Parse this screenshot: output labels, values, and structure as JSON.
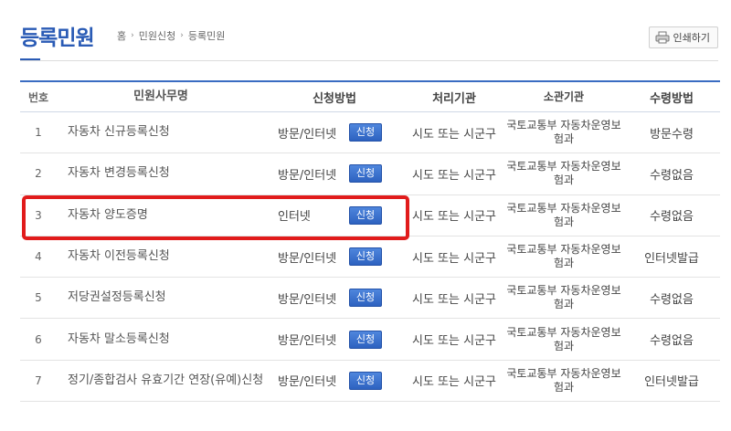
{
  "header": {
    "title": "등록민원",
    "breadcrumb": [
      "홈",
      "민원신청",
      "등록민원"
    ],
    "print_label": "인쇄하기"
  },
  "table": {
    "columns": [
      "번호",
      "민원사무명",
      "신청방법",
      "처리기관",
      "소관기관",
      "수령방법"
    ],
    "apply_label": "신청",
    "rows": [
      {
        "num": "1",
        "name": "자동차 신규등록신청",
        "method": "방문/인터넷",
        "agency": "시도 또는 시군구",
        "dept": "국토교통부 자동차운영보험과",
        "receive": "방문수령"
      },
      {
        "num": "2",
        "name": "자동차 변경등록신청",
        "method": "방문/인터넷",
        "agency": "시도 또는 시군구",
        "dept": "국토교통부 자동차운영보험과",
        "receive": "수령없음"
      },
      {
        "num": "3",
        "name": "자동차 양도증명",
        "method": "인터넷",
        "agency": "시도 또는 시군구",
        "dept": "국토교통부 자동차운영보험과",
        "receive": "수령없음"
      },
      {
        "num": "4",
        "name": "자동차 이전등록신청",
        "method": "방문/인터넷",
        "agency": "시도 또는 시군구",
        "dept": "국토교통부 자동차운영보험과",
        "receive": "인터넷발급"
      },
      {
        "num": "5",
        "name": "저당권설정등록신청",
        "method": "방문/인터넷",
        "agency": "시도 또는 시군구",
        "dept": "국토교통부 자동차운영보험과",
        "receive": "수령없음"
      },
      {
        "num": "6",
        "name": "자동차 말소등록신청",
        "method": "방문/인터넷",
        "agency": "시도 또는 시군구",
        "dept": "국토교통부 자동차운영보험과",
        "receive": "수령없음"
      },
      {
        "num": "7",
        "name": "정기/종합검사 유효기간 연장(유예)신청",
        "method": "방문/인터넷",
        "agency": "시도 또는 시군구",
        "dept": "국토교통부 자동차운영보험과",
        "receive": "인터넷발급"
      }
    ]
  },
  "highlight": {
    "row_index": 2
  },
  "colors": {
    "accent": "#2a5bb5",
    "highlight": "#e11b1b",
    "button": "#3a70c8"
  },
  "icons": {
    "print": "printer-icon",
    "breadcrumb_separator": "chevron-right-icon"
  }
}
